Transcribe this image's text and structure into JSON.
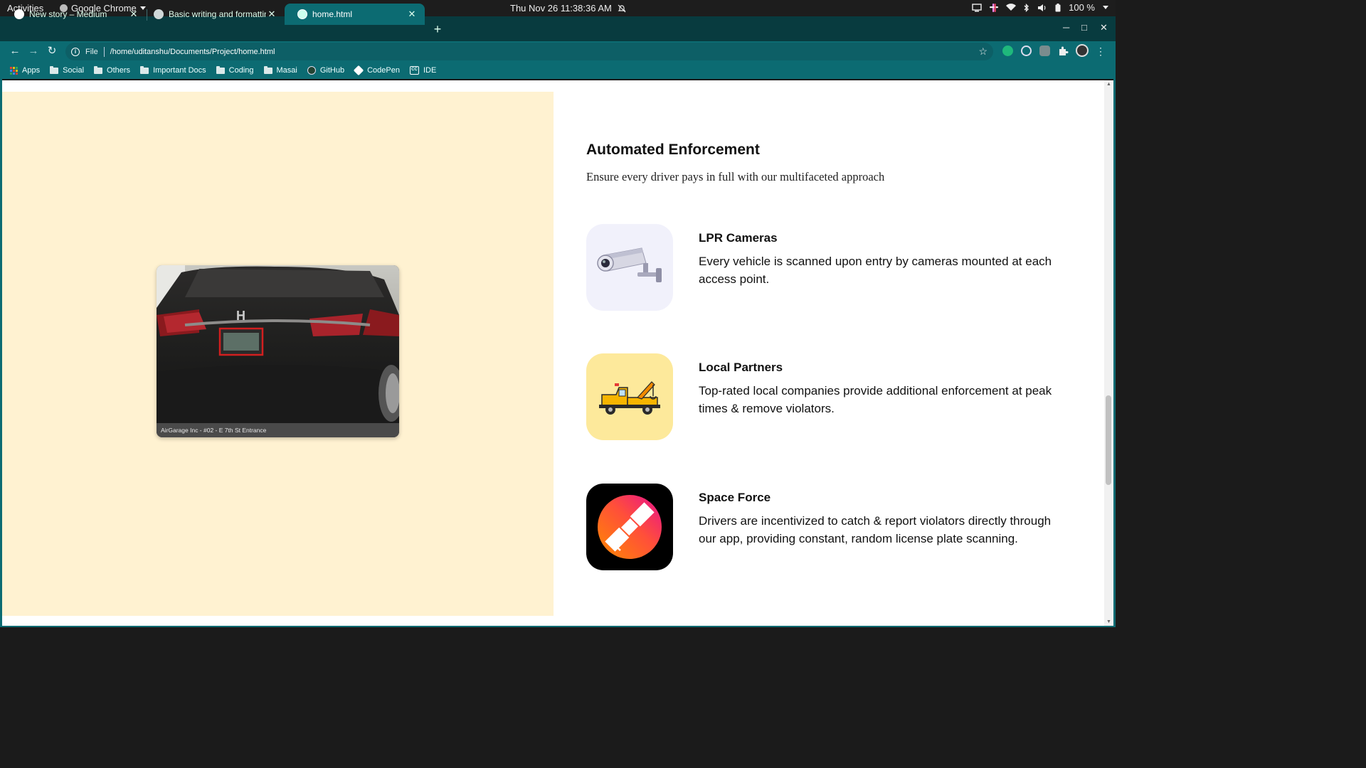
{
  "system_bar": {
    "activities": "Activities",
    "app_name": "Google Chrome",
    "clock": "Thu Nov 26  11:38:36 AM",
    "battery": "100 %"
  },
  "browser": {
    "tabs": [
      {
        "title": "New story – Medium",
        "active": false
      },
      {
        "title": "Basic writing and formatting sy",
        "active": false
      },
      {
        "title": "home.html",
        "active": true
      }
    ],
    "address": {
      "scheme_label": "File",
      "url": "/home/uditanshu/Documents/Project/home.html"
    },
    "bookmarks": [
      {
        "label": "Apps",
        "icon": "apps-grid-icon"
      },
      {
        "label": "Social",
        "icon": "folder-icon"
      },
      {
        "label": "Others",
        "icon": "folder-icon"
      },
      {
        "label": "Important Docs",
        "icon": "folder-icon"
      },
      {
        "label": "Coding",
        "icon": "folder-icon"
      },
      {
        "label": "Masai",
        "icon": "folder-icon"
      },
      {
        "label": "GitHub",
        "icon": "github-icon"
      },
      {
        "label": "CodePen",
        "icon": "codepen-icon"
      },
      {
        "label": "IDE",
        "icon": "ide-icon"
      }
    ]
  },
  "page": {
    "image_caption": "AirGarage Inc - #02 - E 7th St Entrance",
    "section": {
      "title": "Automated Enforcement",
      "subtitle": "Ensure every driver pays in full with our multifaceted approach"
    },
    "features": [
      {
        "title": "LPR Cameras",
        "description": "Every vehicle is scanned upon entry by cameras mounted at each access point.",
        "icon": "security-camera-icon",
        "icon_bg": "#f1f1fb"
      },
      {
        "title": "Local Partners",
        "description": "Top-rated local companies provide additional enforcement at peak times & remove violators.",
        "icon": "tow-truck-icon",
        "icon_bg": "#fde99b"
      },
      {
        "title": "Space Force",
        "description": "Drivers are incentivized to catch & report violators directly through our app, providing constant, random license plate scanning.",
        "icon": "satellite-icon",
        "icon_bg": "#000000"
      }
    ],
    "left_panel_color": "#fff2d1"
  }
}
